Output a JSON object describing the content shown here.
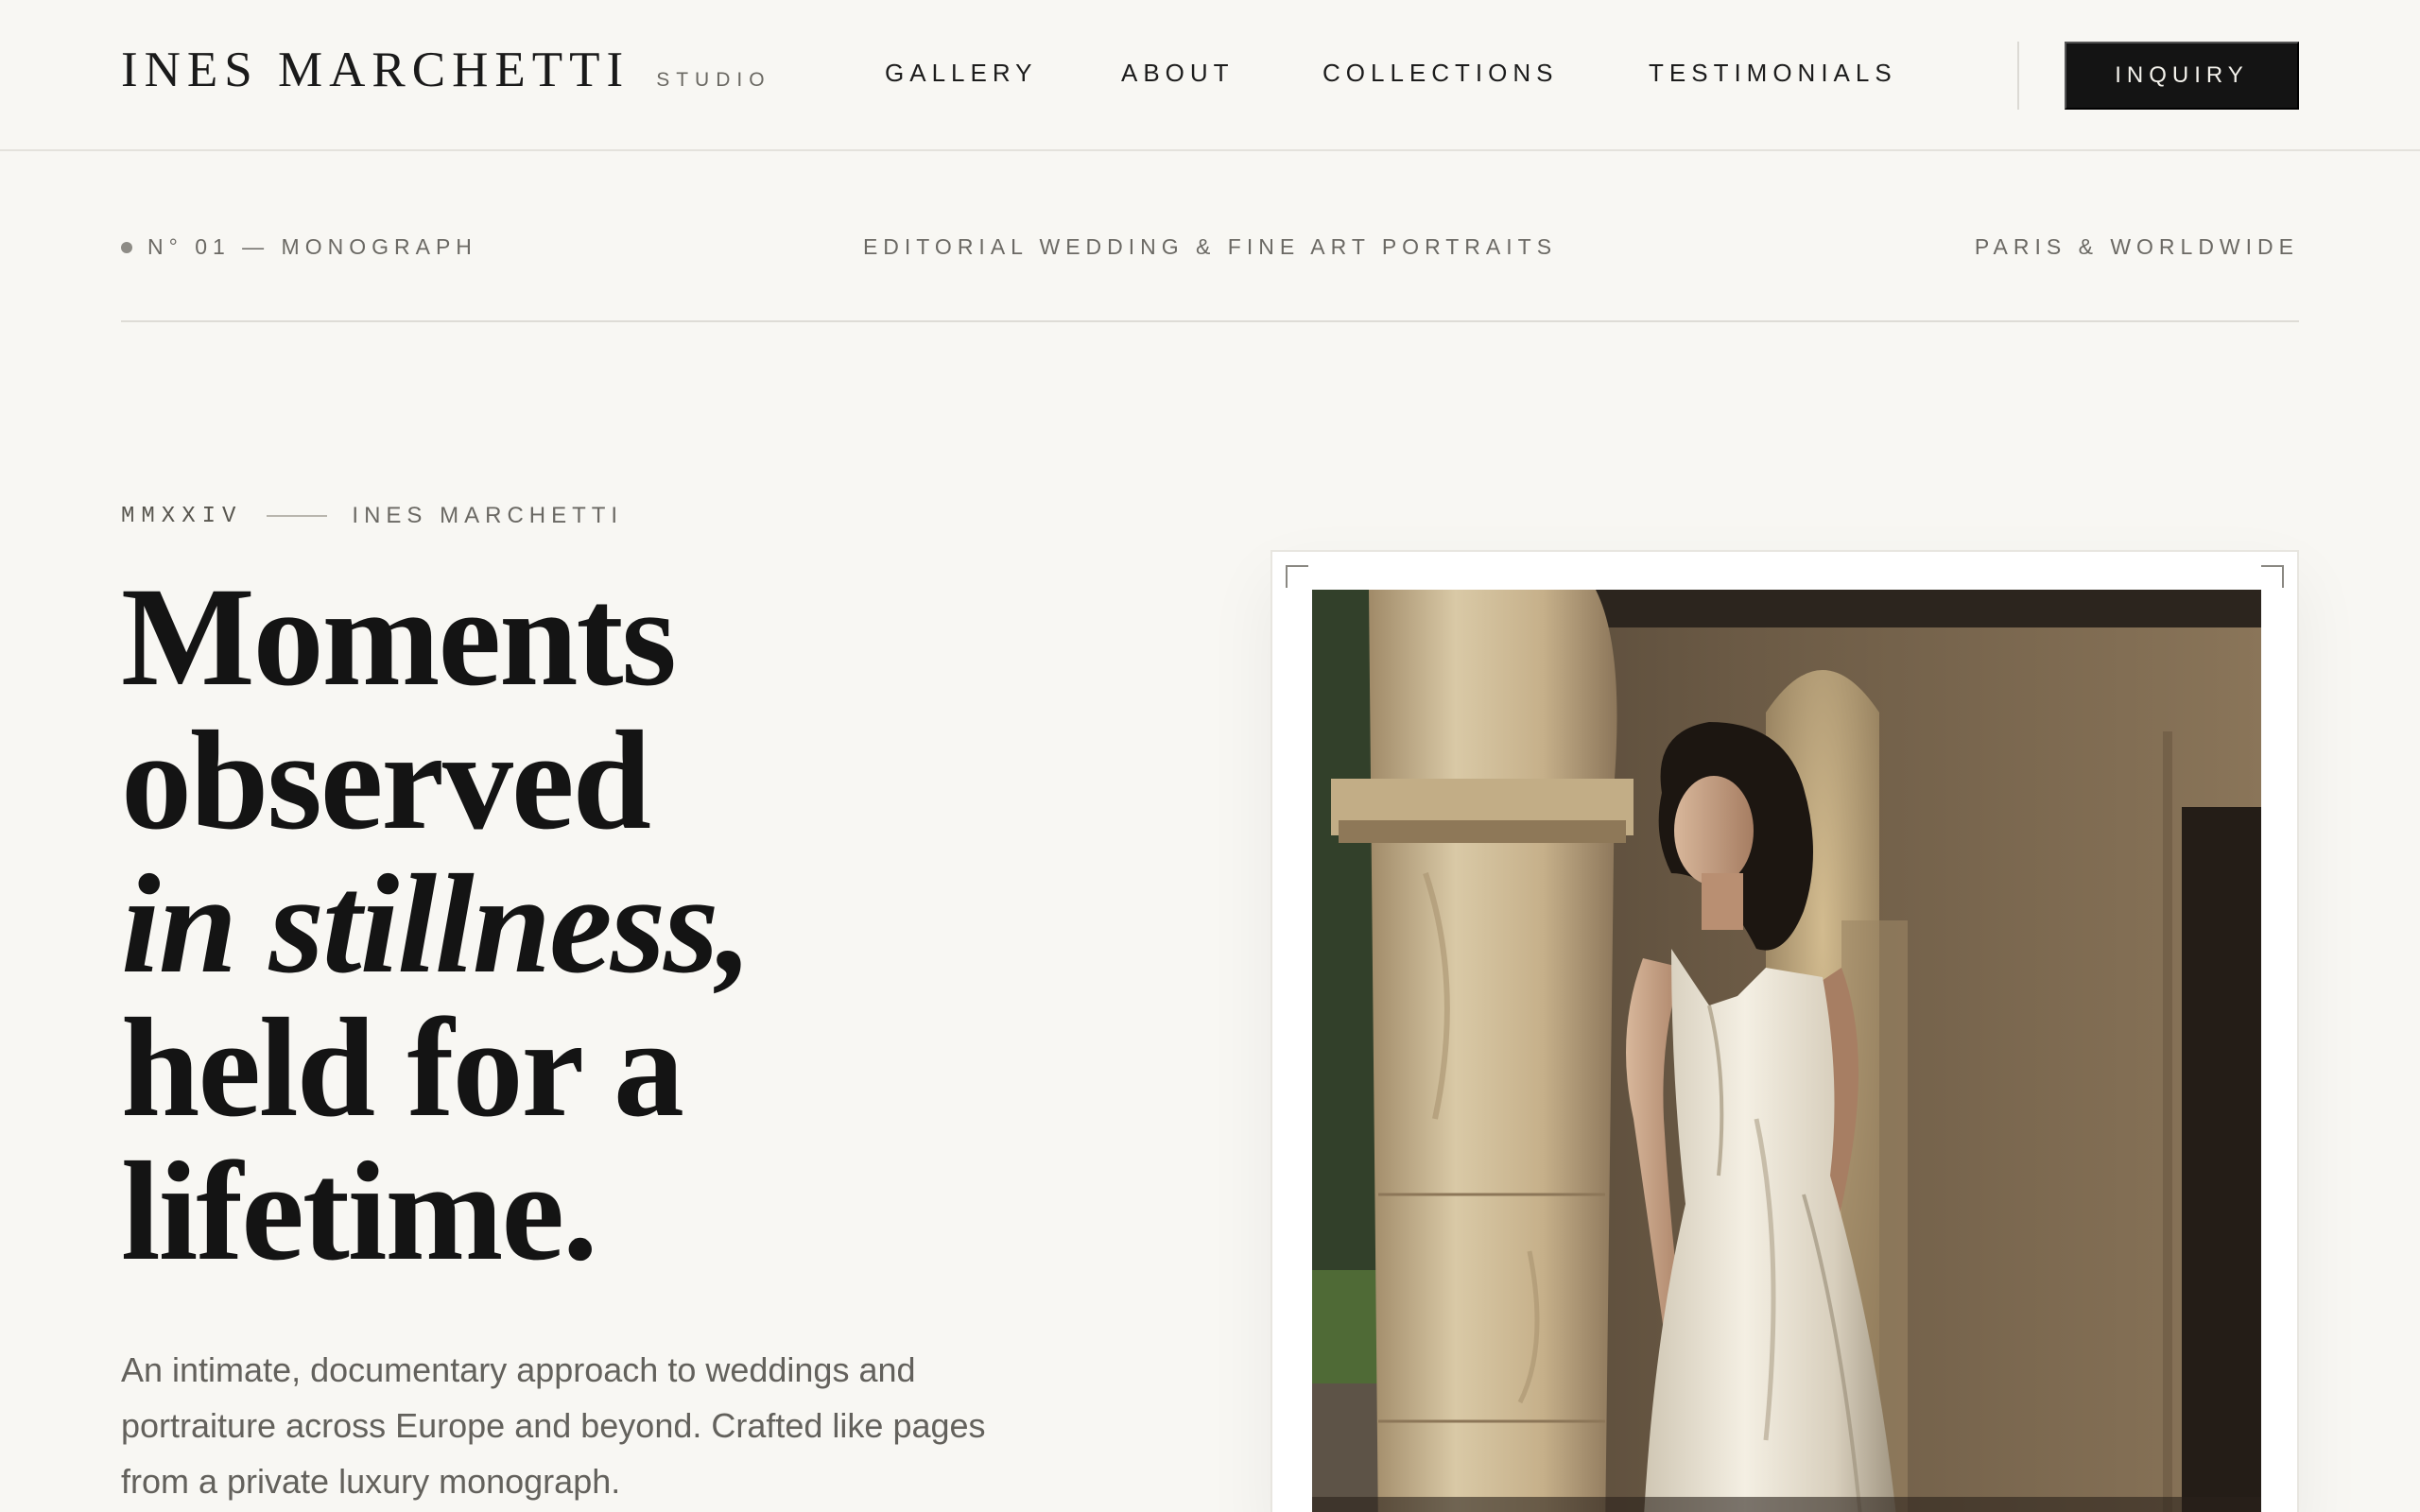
{
  "brand": {
    "name": "INES MARCHETTI",
    "sub": "STUDIO"
  },
  "nav": {
    "items": [
      "GALLERY",
      "ABOUT",
      "COLLECTIONS",
      "TESTIMONIALS"
    ],
    "cta": "INQUIRY"
  },
  "meta": {
    "left": "N° 01 — MONOGRAPH",
    "center": "EDITORIAL WEDDING & FINE ART PORTRAITS",
    "right": "PARIS & WORLDWIDE"
  },
  "hero": {
    "year": "MMXXIV",
    "byline": "INES MARCHETTI",
    "headline": [
      "Moments",
      "observed",
      "in stillness,",
      "held for a",
      "lifetime."
    ],
    "intro": "An intimate, documentary approach to weddings and portraiture across Europe and beyond. Crafted like pages from a private luxury monograph."
  },
  "photo": {
    "subject": "bride-in-silk-dress-under-stone-arch"
  },
  "colors": {
    "background": "#f8f7f3",
    "ink": "#141414",
    "muted": "#6b6964",
    "cta_bg": "#141414"
  }
}
